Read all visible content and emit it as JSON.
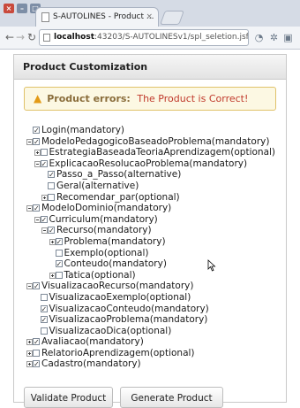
{
  "browser": {
    "tab_title": "S-AUTOLINES - Product ...",
    "tab_close": "×",
    "url_host": "localhost",
    "url_rest": ":43203/S-AUTOLINESv1/spl_seletion.jsf"
  },
  "panel": {
    "title": "Product Customization",
    "alert_title": "Product errors:",
    "alert_message": "The Product is Correct!"
  },
  "tree": [
    {
      "label": "Login(mandatory)",
      "level": 0,
      "expander": "none",
      "checked": true
    },
    {
      "label": "ModeloPedagogicoBaseadoProblema(mandatory)",
      "level": 0,
      "expander": "minus",
      "checked": true
    },
    {
      "label": "EstrategiaBaseadaTeoriaAprendizagem(optional)",
      "level": 1,
      "expander": "plus",
      "checked": false
    },
    {
      "label": "ExplicacaoResolucaoProblema(mandatory)",
      "level": 1,
      "expander": "minus",
      "checked": true
    },
    {
      "label": "Passo_a_Passo(alternative)",
      "level": 2,
      "expander": "none",
      "checked": true
    },
    {
      "label": "Geral(alternative)",
      "level": 2,
      "expander": "none",
      "checked": false
    },
    {
      "label": "Recomendar_par(optional)",
      "level": 2,
      "expander": "plus",
      "checked": false
    },
    {
      "label": "ModeloDominio(mandatory)",
      "level": 0,
      "expander": "minus",
      "checked": true
    },
    {
      "label": "Curriculum(mandatory)",
      "level": 1,
      "expander": "minus",
      "checked": true
    },
    {
      "label": "Recurso(mandatory)",
      "level": 2,
      "expander": "minus",
      "checked": true
    },
    {
      "label": "Problema(mandatory)",
      "level": 3,
      "expander": "plus",
      "checked": true
    },
    {
      "label": "Exemplo(optional)",
      "level": 3,
      "expander": "none",
      "checked": false
    },
    {
      "label": "Conteudo(mandatory)",
      "level": 3,
      "expander": "none",
      "checked": true
    },
    {
      "label": "Tatica(optional)",
      "level": 3,
      "expander": "plus",
      "checked": false
    },
    {
      "label": "VisualizacaoRecurso(mandatory)",
      "level": 0,
      "expander": "minus",
      "checked": true
    },
    {
      "label": "VisualizacaoExemplo(optional)",
      "level": 1,
      "expander": "none",
      "checked": false
    },
    {
      "label": "VisualizacaoConteudo(mandatory)",
      "level": 1,
      "expander": "none",
      "checked": true
    },
    {
      "label": "VisualizacaoProblema(mandatory)",
      "level": 1,
      "expander": "none",
      "checked": true
    },
    {
      "label": "VisualizacaoDica(optional)",
      "level": 1,
      "expander": "none",
      "checked": false
    },
    {
      "label": "Avaliacao(mandatory)",
      "level": 0,
      "expander": "plus",
      "checked": true
    },
    {
      "label": "RelatorioAprendizagem(optional)",
      "level": 0,
      "expander": "plus",
      "checked": false
    },
    {
      "label": "Cadastro(mandatory)",
      "level": 0,
      "expander": "plus",
      "checked": true
    }
  ],
  "buttons": {
    "validate": "Validate Product",
    "generate": "Generate Product"
  },
  "colors": {
    "alert_bg": "#fcf8e3",
    "alert_icon": "#e39a17",
    "alert_message": "#c0392b"
  },
  "icons": [
    "close-icon",
    "minimize-icon",
    "maximize-icon",
    "back-arrow-icon",
    "forward-arrow-icon",
    "reload-icon",
    "page-icon",
    "star-icon",
    "warning-icon",
    "mouse-cursor-icon"
  ]
}
